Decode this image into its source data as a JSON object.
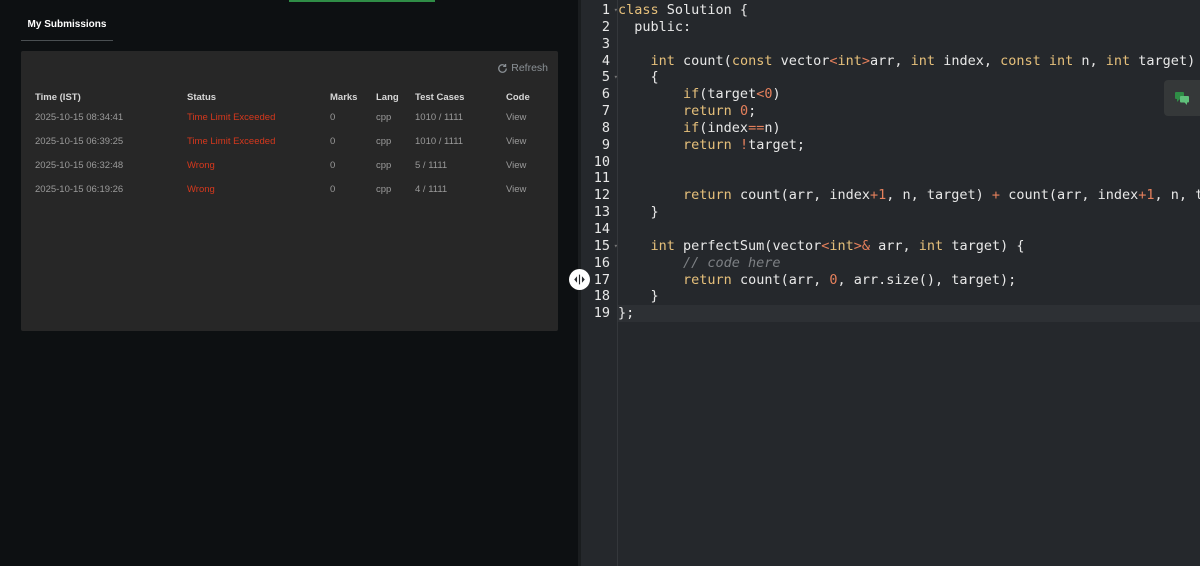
{
  "submissions_tab": {
    "label": "My Submissions"
  },
  "refresh": {
    "label": "Refresh"
  },
  "table": {
    "headers": {
      "time": "Time (IST)",
      "status": "Status",
      "marks": "Marks",
      "lang": "Lang",
      "test_cases": "Test Cases",
      "code": "Code"
    },
    "rows": [
      {
        "time": "2025-10-15 08:34:41",
        "status": "Time Limit Exceeded",
        "marks": "0",
        "lang": "cpp",
        "test_cases": "1010 / 1111",
        "code": "View"
      },
      {
        "time": "2025-10-15 06:39:25",
        "status": "Time Limit Exceeded",
        "marks": "0",
        "lang": "cpp",
        "test_cases": "1010 / 1111",
        "code": "View"
      },
      {
        "time": "2025-10-15 06:32:48",
        "status": "Wrong",
        "marks": "0",
        "lang": "cpp",
        "test_cases": "5 / 1111",
        "code": "View"
      },
      {
        "time": "2025-10-15 06:19:26",
        "status": "Wrong",
        "marks": "0",
        "lang": "cpp",
        "test_cases": "4 / 1111",
        "code": "View"
      }
    ]
  },
  "editor": {
    "line_numbers": [
      "1",
      "2",
      "3",
      "4",
      "5",
      "6",
      "7",
      "8",
      "9",
      "10",
      "11",
      "12",
      "13",
      "14",
      "15",
      "16",
      "17",
      "18",
      "19"
    ],
    "lines": [
      [
        {
          "t": "class ",
          "c": "kw"
        },
        {
          "t": "Solution {",
          "c": "pn"
        }
      ],
      [
        {
          "t": "  public:",
          "c": "pn"
        }
      ],
      [
        {
          "t": "",
          "c": "pn"
        }
      ],
      [
        {
          "t": "    ",
          "c": "pn"
        },
        {
          "t": "int",
          "c": "ty"
        },
        {
          "t": " count(",
          "c": "pn"
        },
        {
          "t": "const",
          "c": "ty"
        },
        {
          "t": " vector",
          "c": "pn"
        },
        {
          "t": "<",
          "c": "op"
        },
        {
          "t": "int",
          "c": "ty"
        },
        {
          "t": ">",
          "c": "op"
        },
        {
          "t": "arr, ",
          "c": "pn"
        },
        {
          "t": "int",
          "c": "ty"
        },
        {
          "t": " index, ",
          "c": "pn"
        },
        {
          "t": "const",
          "c": "ty"
        },
        {
          "t": " ",
          "c": "pn"
        },
        {
          "t": "int",
          "c": "ty"
        },
        {
          "t": " n, ",
          "c": "pn"
        },
        {
          "t": "int",
          "c": "ty"
        },
        {
          "t": " target)",
          "c": "pn"
        }
      ],
      [
        {
          "t": "    {",
          "c": "pn"
        }
      ],
      [
        {
          "t": "        ",
          "c": "pn"
        },
        {
          "t": "if",
          "c": "kw"
        },
        {
          "t": "(target",
          "c": "pn"
        },
        {
          "t": "<",
          "c": "op"
        },
        {
          "t": "0",
          "c": "num"
        },
        {
          "t": ")",
          "c": "pn"
        }
      ],
      [
        {
          "t": "        ",
          "c": "pn"
        },
        {
          "t": "return",
          "c": "kw"
        },
        {
          "t": " ",
          "c": "pn"
        },
        {
          "t": "0",
          "c": "num"
        },
        {
          "t": ";",
          "c": "pn"
        }
      ],
      [
        {
          "t": "        ",
          "c": "pn"
        },
        {
          "t": "if",
          "c": "kw"
        },
        {
          "t": "(index",
          "c": "pn"
        },
        {
          "t": "==",
          "c": "op"
        },
        {
          "t": "n)",
          "c": "pn"
        }
      ],
      [
        {
          "t": "        ",
          "c": "pn"
        },
        {
          "t": "return",
          "c": "kw"
        },
        {
          "t": " ",
          "c": "pn"
        },
        {
          "t": "!",
          "c": "op"
        },
        {
          "t": "target;",
          "c": "pn"
        }
      ],
      [
        {
          "t": "",
          "c": "pn"
        }
      ],
      [
        {
          "t": "",
          "c": "pn"
        }
      ],
      [
        {
          "t": "        ",
          "c": "pn"
        },
        {
          "t": "return",
          "c": "kw"
        },
        {
          "t": " count(arr, index",
          "c": "pn"
        },
        {
          "t": "+1",
          "c": "op"
        },
        {
          "t": ", n, target) ",
          "c": "pn"
        },
        {
          "t": "+",
          "c": "op"
        },
        {
          "t": " count(arr, index",
          "c": "pn"
        },
        {
          "t": "+1",
          "c": "op"
        },
        {
          "t": ", n, target",
          "c": "pn"
        }
      ],
      [
        {
          "t": "    }",
          "c": "pn"
        }
      ],
      [
        {
          "t": "",
          "c": "pn"
        }
      ],
      [
        {
          "t": "    ",
          "c": "pn"
        },
        {
          "t": "int",
          "c": "ty"
        },
        {
          "t": " perfectSum(vector",
          "c": "pn"
        },
        {
          "t": "<",
          "c": "op"
        },
        {
          "t": "int",
          "c": "ty"
        },
        {
          "t": ">&",
          "c": "op"
        },
        {
          "t": " arr, ",
          "c": "pn"
        },
        {
          "t": "int",
          "c": "ty"
        },
        {
          "t": " target) {",
          "c": "pn"
        }
      ],
      [
        {
          "t": "        ",
          "c": "pn"
        },
        {
          "t": "// code here",
          "c": "cm"
        }
      ],
      [
        {
          "t": "        ",
          "c": "pn"
        },
        {
          "t": "return",
          "c": "kw"
        },
        {
          "t": " count(arr, ",
          "c": "pn"
        },
        {
          "t": "0",
          "c": "num"
        },
        {
          "t": ", arr.size(), target);",
          "c": "pn"
        }
      ],
      [
        {
          "t": "    }",
          "c": "pn"
        }
      ],
      [
        {
          "t": "};",
          "c": "pn"
        }
      ]
    ],
    "fold_markers": [
      1,
      5,
      15
    ],
    "active_line": 19
  },
  "icons": {
    "refresh": "refresh-icon",
    "resize": "resize-handle-icon",
    "chat": "chat-icon"
  },
  "colors": {
    "accent": "#2f8d46",
    "status_error": "#d5381d"
  }
}
